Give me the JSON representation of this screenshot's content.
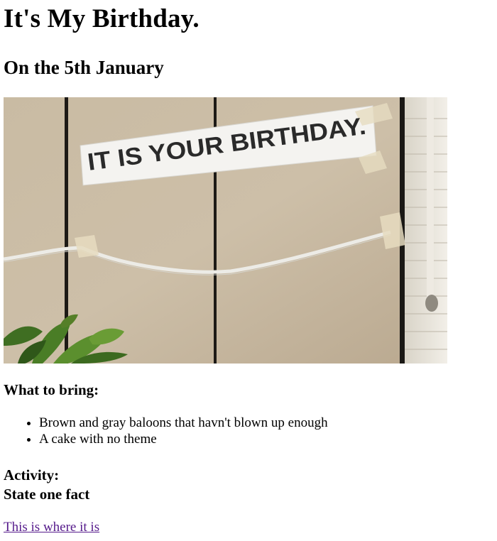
{
  "page": {
    "title": "It's My Birthday.",
    "subtitle": "On the 5th January"
  },
  "image": {
    "banner_text": "IT IS YOUR BIRTHDAY."
  },
  "bring": {
    "heading": "What to bring:",
    "items": [
      "Brown and gray baloons that havn't blown up enough",
      "A cake with no theme"
    ]
  },
  "activity": {
    "label": "Activity:",
    "text": "State one fact"
  },
  "link": {
    "text": "This is where it is"
  }
}
